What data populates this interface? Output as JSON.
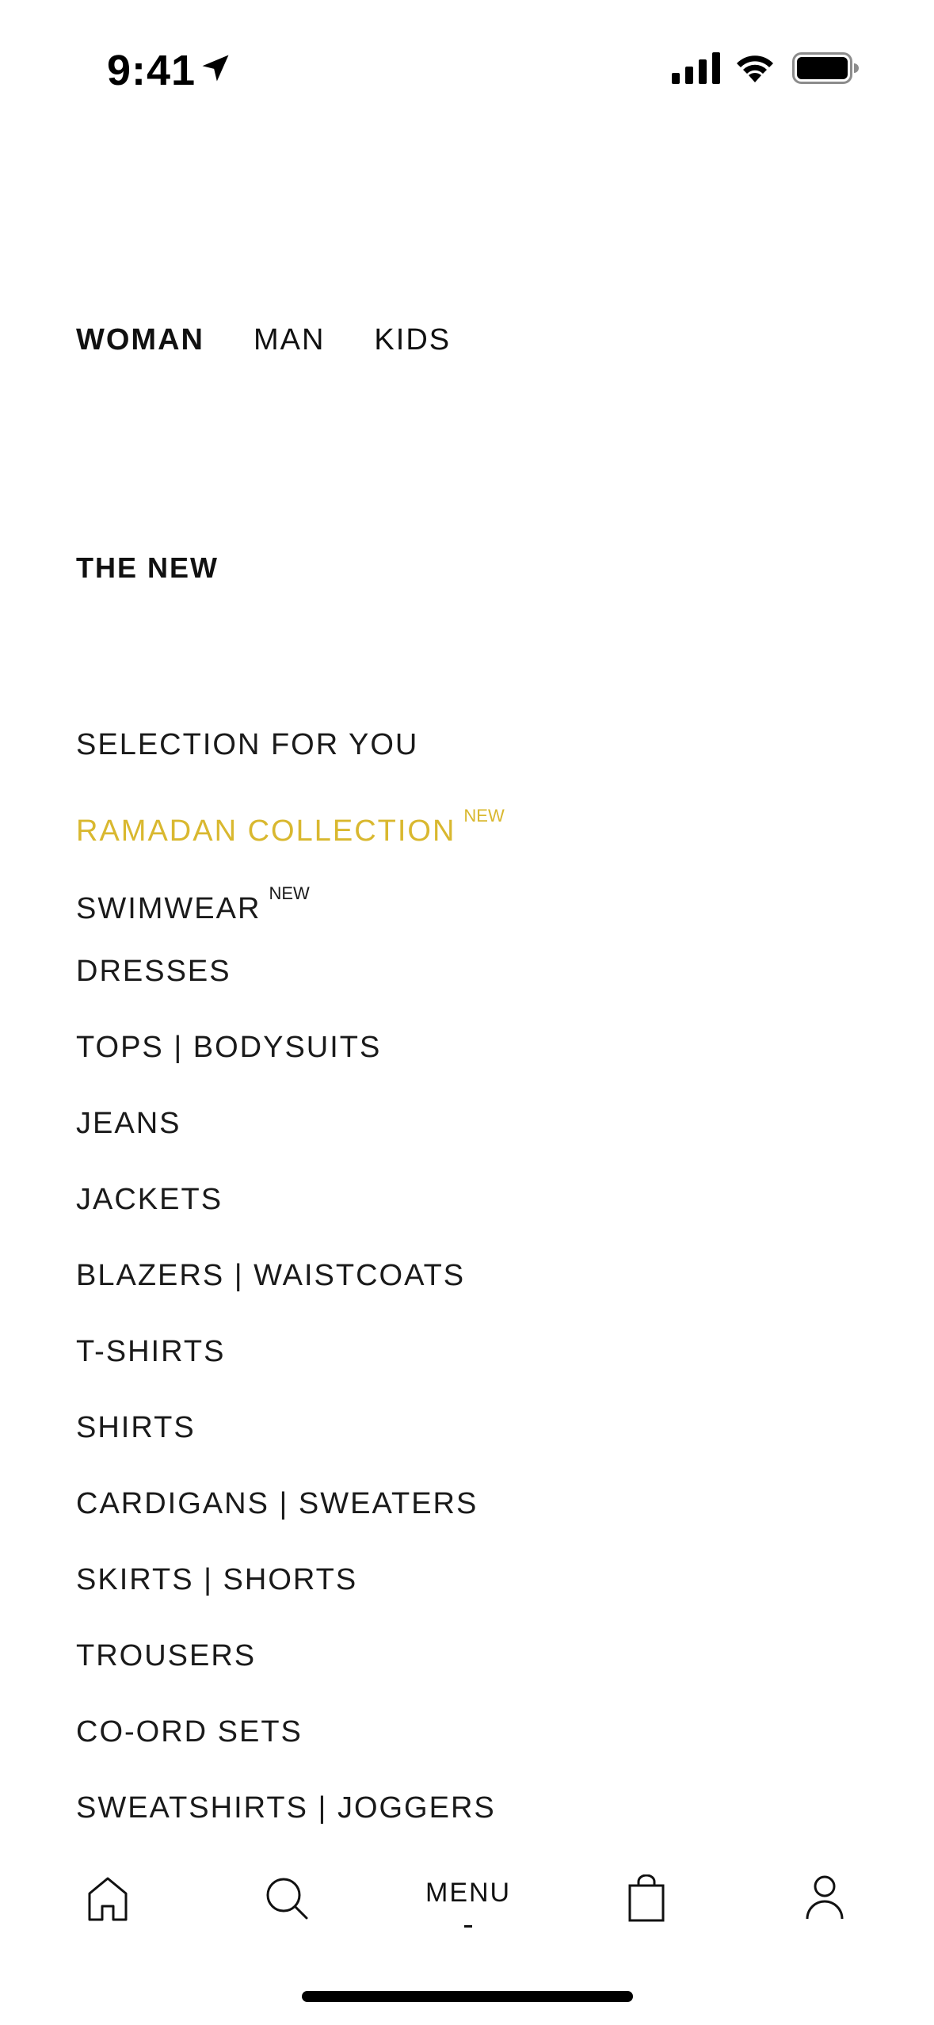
{
  "status_bar": {
    "time": "9:41",
    "icons": [
      "location-arrow-icon",
      "cellular-signal-icon",
      "wifi-icon",
      "battery-icon"
    ]
  },
  "gender_tabs": [
    {
      "label": "WOMAN",
      "active": true
    },
    {
      "label": "MAN",
      "active": false
    },
    {
      "label": "KIDS",
      "active": false
    }
  ],
  "section_heading": "THE NEW",
  "menu_items": [
    {
      "label": "SELECTION FOR YOU",
      "badge": ""
    },
    {
      "label": "RAMADAN COLLECTION",
      "badge": "NEW",
      "highlight": true
    },
    {
      "label": "SWIMWEAR",
      "badge": "NEW"
    },
    {
      "label": "DRESSES",
      "badge": ""
    },
    {
      "label": "TOPS | BODYSUITS",
      "badge": ""
    },
    {
      "label": "JEANS",
      "badge": ""
    },
    {
      "label": "JACKETS",
      "badge": ""
    },
    {
      "label": "BLAZERS | WAISTCOATS",
      "badge": ""
    },
    {
      "label": "T-SHIRTS",
      "badge": ""
    },
    {
      "label": "SHIRTS",
      "badge": ""
    },
    {
      "label": "CARDIGANS | SWEATERS",
      "badge": ""
    },
    {
      "label": "SKIRTS | SHORTS",
      "badge": ""
    },
    {
      "label": "TROUSERS",
      "badge": ""
    },
    {
      "label": "CO-ORD SETS",
      "badge": ""
    },
    {
      "label": "SWEATSHIRTS | JOGGERS",
      "badge": ""
    }
  ],
  "bottom_nav": {
    "menu_label": "MENU",
    "icons": [
      "home-icon",
      "search-icon",
      "shopping-bag-icon",
      "account-icon"
    ]
  },
  "colors": {
    "highlight": "#d9b82f",
    "text": "#1a1a1a",
    "background": "#ffffff"
  }
}
